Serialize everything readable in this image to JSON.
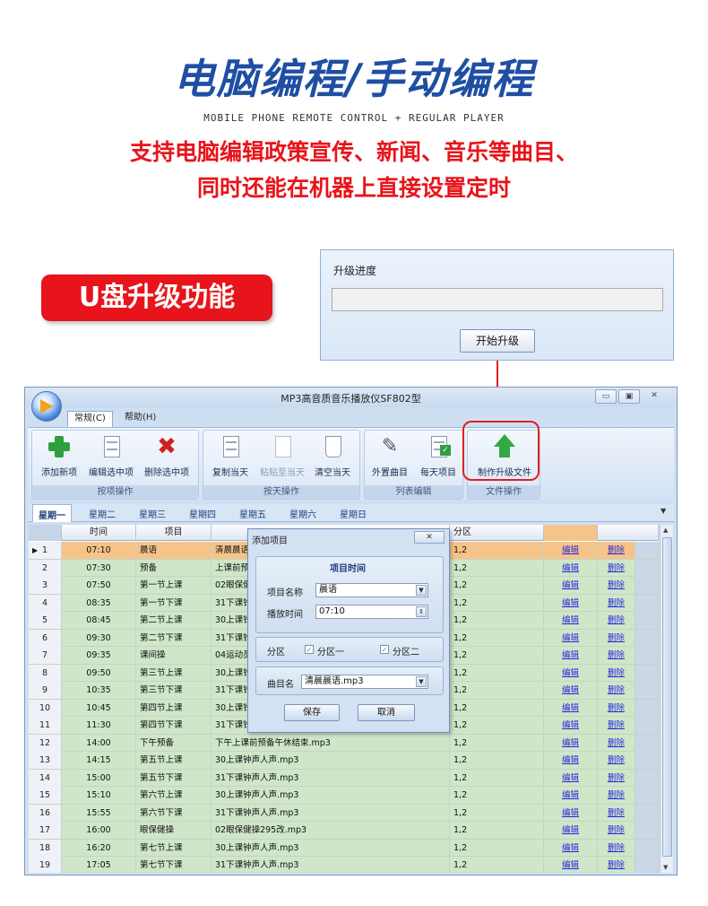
{
  "header": {
    "title": "电脑编程/手动编程",
    "subtitle_en": "MOBILE PHONE REMOTE CONTROL + REGULAR PLAYER",
    "line1": "支持电脑编辑政策宣传、新闻、音乐等曲目、",
    "line2": "同时还能在机器上直接设置定时"
  },
  "usb_badge": "U盘升级功能",
  "upgrade_panel": {
    "label": "升级进度",
    "progress": 0,
    "button": "开始升级"
  },
  "app": {
    "title": "MP3高音质音乐播放仪SF802型",
    "window_buttons": {
      "minimize": "▭",
      "maximize": "▣",
      "close": "✕"
    },
    "menu_tabs": [
      "常规(C)",
      "帮助(H)"
    ],
    "ribbon": {
      "groups": [
        {
          "label": "按项操作",
          "buttons": [
            "添加新项",
            "编辑选中项",
            "删除选中项"
          ]
        },
        {
          "label": "按天操作",
          "buttons": [
            "复制当天",
            "粘贴至当天",
            "清空当天"
          ]
        },
        {
          "label": "列表编辑",
          "buttons": [
            "外置曲目",
            "每天项目"
          ]
        },
        {
          "label": "文件操作",
          "buttons": [
            "制作升级文件"
          ]
        }
      ]
    },
    "day_tabs": [
      "星期一",
      "星期二",
      "星期三",
      "星期四",
      "星期五",
      "星期六",
      "星期日"
    ],
    "table": {
      "headers": [
        "",
        "时间",
        "项目",
        "",
        "分区",
        "",
        ""
      ],
      "rows": [
        {
          "n": "1",
          "time": "07:10",
          "item": "晨语",
          "file": "清晨晨语",
          "zone": "1,2"
        },
        {
          "n": "2",
          "time": "07:30",
          "item": "预备",
          "file": "上课前预",
          "zone": "1,2"
        },
        {
          "n": "3",
          "time": "07:50",
          "item": "第一节上课",
          "file": "02眼保健",
          "zone": "1,2"
        },
        {
          "n": "4",
          "time": "08:35",
          "item": "第一节下课",
          "file": "31下课铃",
          "zone": "1,2"
        },
        {
          "n": "5",
          "time": "08:45",
          "item": "第二节上课",
          "file": "30上课铃",
          "zone": "1,2"
        },
        {
          "n": "6",
          "time": "09:30",
          "item": "第二节下课",
          "file": "31下课铃",
          "zone": "1,2"
        },
        {
          "n": "7",
          "time": "09:35",
          "item": "课间操",
          "file": "04运动员",
          "zone": "1,2"
        },
        {
          "n": "8",
          "time": "09:50",
          "item": "第三节上课",
          "file": "30上课铃",
          "zone": "1,2"
        },
        {
          "n": "9",
          "time": "10:35",
          "item": "第三节下课",
          "file": "31下课铃",
          "zone": "1,2"
        },
        {
          "n": "10",
          "time": "10:45",
          "item": "第四节上课",
          "file": "30上课铃",
          "zone": "1,2"
        },
        {
          "n": "11",
          "time": "11:30",
          "item": "第四节下课",
          "file": "31下课铃",
          "zone": "1,2"
        },
        {
          "n": "12",
          "time": "14:00",
          "item": "下午预备",
          "file": "下午上课前预备午休结束.mp3",
          "zone": "1,2"
        },
        {
          "n": "13",
          "time": "14:15",
          "item": "第五节上课",
          "file": "30上课钟声人声.mp3",
          "zone": "1,2"
        },
        {
          "n": "14",
          "time": "15:00",
          "item": "第五节下课",
          "file": "31下课钟声人声.mp3",
          "zone": "1,2"
        },
        {
          "n": "15",
          "time": "15:10",
          "item": "第六节上课",
          "file": "30上课钟声人声.mp3",
          "zone": "1,2"
        },
        {
          "n": "16",
          "time": "15:55",
          "item": "第六节下课",
          "file": "31下课钟声人声.mp3",
          "zone": "1,2"
        },
        {
          "n": "17",
          "time": "16:00",
          "item": "眼保健操",
          "file": "02眼保健操295改.mp3",
          "zone": "1,2"
        },
        {
          "n": "18",
          "time": "16:20",
          "item": "第七节上课",
          "file": "30上课钟声人声.mp3",
          "zone": "1,2"
        },
        {
          "n": "19",
          "time": "17:05",
          "item": "第七节下课",
          "file": "31下课钟声人声.mp3",
          "zone": "1,2"
        }
      ],
      "edit_label": "编辑",
      "delete_label": "删除"
    },
    "dialog": {
      "title": "添加项目",
      "close": "✕",
      "section_title": "项目时间",
      "name_label": "项目名称",
      "name_value": "晨语",
      "time_label": "播放时间",
      "time_value": "07:10",
      "zone_label": "分区",
      "zone1": "分区一",
      "zone2": "分区二",
      "song_label": "曲目名",
      "song_value": "清晨晨语.mp3",
      "save": "保存",
      "cancel": "取消"
    }
  }
}
